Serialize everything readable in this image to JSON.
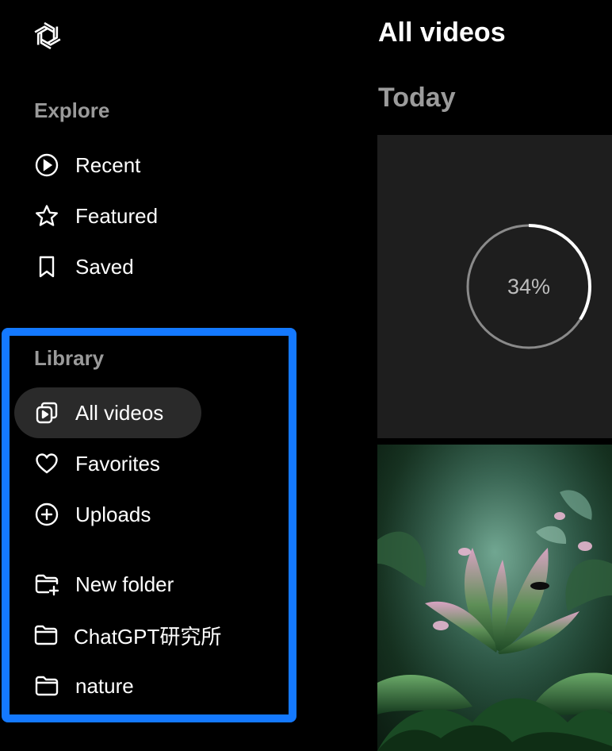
{
  "sidebar": {
    "explore_title": "Explore",
    "library_title": "Library",
    "explore_items": [
      {
        "label": "Recent",
        "icon": "play-circle-icon"
      },
      {
        "label": "Featured",
        "icon": "star-icon"
      },
      {
        "label": "Saved",
        "icon": "bookmark-icon"
      }
    ],
    "library_items": [
      {
        "label": "All videos",
        "icon": "videos-icon",
        "active": true
      },
      {
        "label": "Favorites",
        "icon": "heart-icon"
      },
      {
        "label": "Uploads",
        "icon": "plus-circle-icon"
      }
    ],
    "folders": [
      {
        "label": "New folder",
        "icon": "new-folder-icon"
      },
      {
        "label": "ChatGPT研究所",
        "icon": "folder-icon"
      },
      {
        "label": "nature",
        "icon": "folder-icon"
      }
    ]
  },
  "main": {
    "title": "All videos",
    "group_title": "Today",
    "progress_label": "34%",
    "progress_value": 0.34
  },
  "colors": {
    "background": "#000000",
    "highlight": "#1479ff",
    "active_item_bg": "#2a2a2a",
    "muted_text": "#9a9a9a"
  }
}
